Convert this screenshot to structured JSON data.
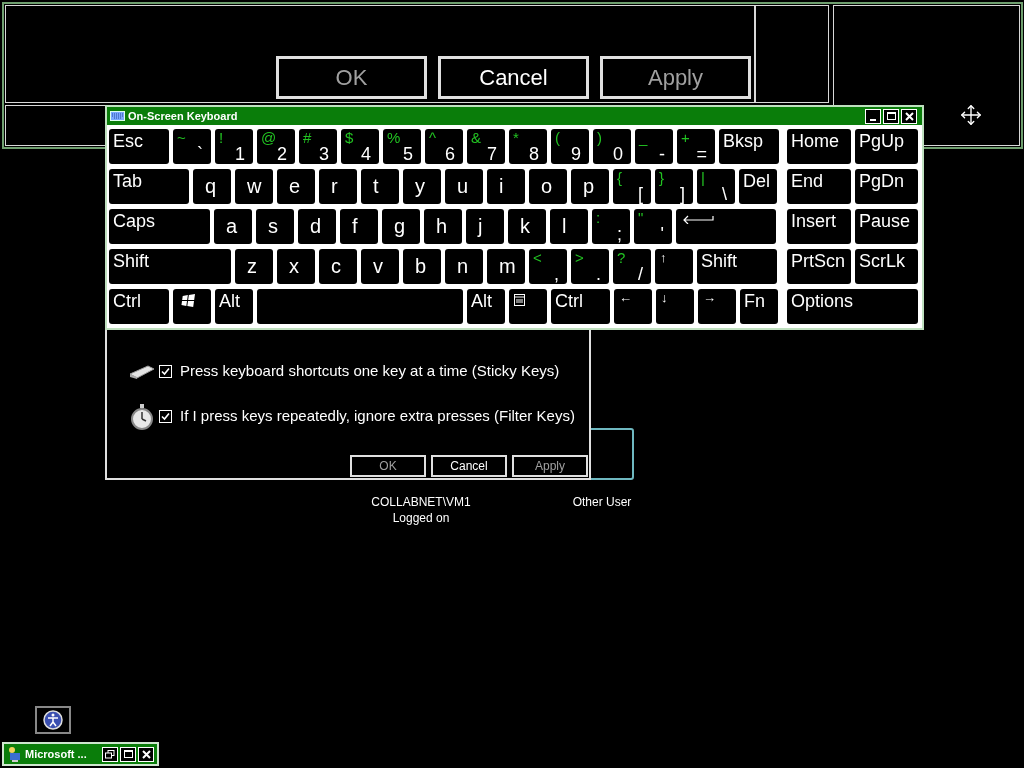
{
  "background_window": {
    "buttons": [
      {
        "label": "OK",
        "disabled": true
      },
      {
        "label": "Cancel",
        "disabled": false
      },
      {
        "label": "Apply",
        "disabled": true
      }
    ]
  },
  "user_tiles": [
    {
      "name": "COLLABNET\\VM1",
      "status": "Logged on"
    },
    {
      "name": "Other User"
    }
  ],
  "settings_dialog": {
    "options": [
      {
        "kind": "keys",
        "label": "Press keyboard shortcuts one key at a time (Sticky Keys)",
        "checked": true
      },
      {
        "kind": "stopwatch",
        "label": "If I press keys repeatedly, ignore extra presses (Filter Keys)",
        "checked": true
      }
    ],
    "buttons": [
      {
        "label": "OK",
        "disabled": true
      },
      {
        "label": "Cancel",
        "disabled": false
      },
      {
        "label": "Apply",
        "disabled": true
      }
    ]
  },
  "keyboard": {
    "title": "On-Screen Keyboard",
    "main_rows": [
      [
        {
          "kind": "word",
          "label": "Esc"
        },
        {
          "kind": "dual",
          "shift": "~",
          "base": "`"
        },
        {
          "kind": "dual",
          "shift": "!",
          "base": "1"
        },
        {
          "kind": "dual",
          "shift": "@",
          "base": "2"
        },
        {
          "kind": "dual",
          "shift": "#",
          "base": "3"
        },
        {
          "kind": "dual",
          "shift": "$",
          "base": "4"
        },
        {
          "kind": "dual",
          "shift": "%",
          "base": "5"
        },
        {
          "kind": "dual",
          "shift": "^",
          "base": "6"
        },
        {
          "kind": "dual",
          "shift": "&",
          "base": "7"
        },
        {
          "kind": "dual",
          "shift": "*",
          "base": "8"
        },
        {
          "kind": "dual",
          "shift": "(",
          "base": "9"
        },
        {
          "kind": "dual",
          "shift": ")",
          "base": "0"
        },
        {
          "kind": "dual",
          "shift": "_",
          "base": "-"
        },
        {
          "kind": "dual",
          "shift": "+",
          "base": "="
        },
        {
          "kind": "word",
          "label": "Bksp"
        }
      ],
      [
        {
          "kind": "word",
          "label": "Tab"
        },
        {
          "kind": "letter",
          "label": "q"
        },
        {
          "kind": "letter",
          "label": "w"
        },
        {
          "kind": "letter",
          "label": "e"
        },
        {
          "kind": "letter",
          "label": "r"
        },
        {
          "kind": "letter",
          "label": "t"
        },
        {
          "kind": "letter",
          "label": "y"
        },
        {
          "kind": "letter",
          "label": "u"
        },
        {
          "kind": "letter",
          "label": "i"
        },
        {
          "kind": "letter",
          "label": "o"
        },
        {
          "kind": "letter",
          "label": "p"
        },
        {
          "kind": "dual",
          "shift": "{",
          "base": "["
        },
        {
          "kind": "dual",
          "shift": "}",
          "base": "]"
        },
        {
          "kind": "dual",
          "shift": "|",
          "base": "\\"
        },
        {
          "kind": "word",
          "label": "Del"
        }
      ],
      [
        {
          "kind": "word",
          "label": "Caps"
        },
        {
          "kind": "letter",
          "label": "a"
        },
        {
          "kind": "letter",
          "label": "s"
        },
        {
          "kind": "letter",
          "label": "d"
        },
        {
          "kind": "letter",
          "label": "f"
        },
        {
          "kind": "letter",
          "label": "g"
        },
        {
          "kind": "letter",
          "label": "h"
        },
        {
          "kind": "letter",
          "label": "j"
        },
        {
          "kind": "letter",
          "label": "k"
        },
        {
          "kind": "letter",
          "label": "l"
        },
        {
          "kind": "dual",
          "shift": ":",
          "base": ";"
        },
        {
          "kind": "dual",
          "shift": "\"",
          "base": "'"
        },
        {
          "kind": "enter"
        }
      ],
      [
        {
          "kind": "word",
          "label": "Shift"
        },
        {
          "kind": "letter",
          "label": "z"
        },
        {
          "kind": "letter",
          "label": "x"
        },
        {
          "kind": "letter",
          "label": "c"
        },
        {
          "kind": "letter",
          "label": "v"
        },
        {
          "kind": "letter",
          "label": "b"
        },
        {
          "kind": "letter",
          "label": "n"
        },
        {
          "kind": "letter",
          "label": "m"
        },
        {
          "kind": "dual",
          "shift": "<",
          "base": ","
        },
        {
          "kind": "dual",
          "shift": ">",
          "base": "."
        },
        {
          "kind": "dual",
          "shift": "?",
          "base": "/"
        },
        {
          "kind": "arrow",
          "label": "↑"
        },
        {
          "kind": "word",
          "label": "Shift"
        }
      ],
      [
        {
          "kind": "word",
          "label": "Ctrl"
        },
        {
          "kind": "windows"
        },
        {
          "kind": "word",
          "label": "Alt"
        },
        {
          "kind": "space"
        },
        {
          "kind": "word",
          "label": "Alt"
        },
        {
          "kind": "menu"
        },
        {
          "kind": "word",
          "label": "Ctrl"
        },
        {
          "kind": "arrow",
          "label": "←"
        },
        {
          "kind": "arrow",
          "label": "↓"
        },
        {
          "kind": "arrow",
          "label": "→"
        },
        {
          "kind": "word",
          "label": "Fn"
        }
      ]
    ],
    "nav_rows": [
      [
        {
          "kind": "word",
          "label": "Home"
        },
        {
          "kind": "word",
          "label": "PgUp"
        }
      ],
      [
        {
          "kind": "word",
          "label": "End"
        },
        {
          "kind": "word",
          "label": "PgDn"
        }
      ],
      [
        {
          "kind": "word",
          "label": "Insert"
        },
        {
          "kind": "word",
          "label": "Pause"
        }
      ],
      [
        {
          "kind": "word",
          "label": "PrtScn"
        },
        {
          "kind": "word",
          "label": "ScrLk"
        }
      ],
      [
        {
          "kind": "word",
          "label": "Options"
        }
      ]
    ]
  },
  "taskbar": {
    "items": [
      {
        "label": "Microsoft ..."
      }
    ]
  }
}
